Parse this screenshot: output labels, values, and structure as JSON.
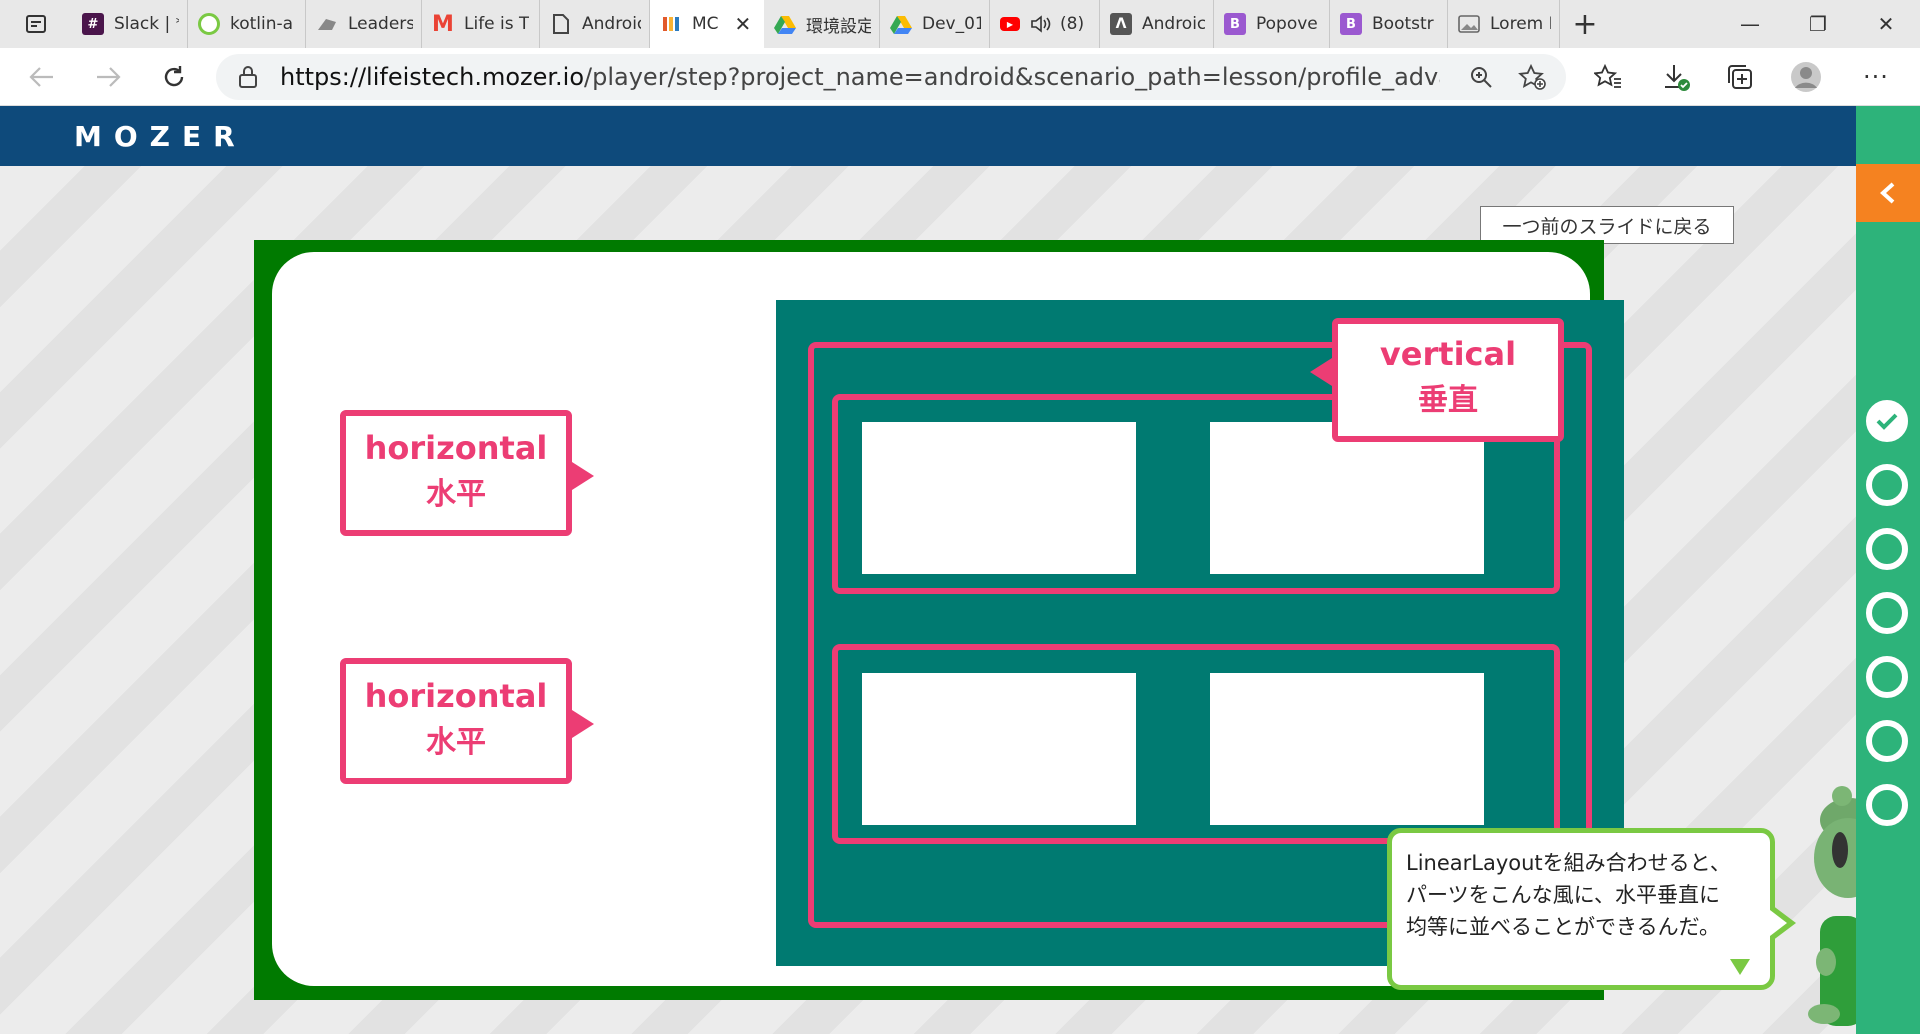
{
  "browser": {
    "tabs": [
      {
        "label": "Slack | *",
        "icon": "slack-icon",
        "color": "#4a154b"
      },
      {
        "label": "kotlin-a",
        "icon": "kotlin-icon",
        "color": "#7ac943"
      },
      {
        "label": "Leaders",
        "icon": "cloud-icon",
        "color": "#888888"
      },
      {
        "label": "Life is T",
        "icon": "gmail-icon",
        "color": "#ea4335"
      },
      {
        "label": "Androic",
        "icon": "page-icon",
        "color": "#555555"
      },
      {
        "label": "MC",
        "icon": "mozer-icon",
        "color": "#e25a2b",
        "active": true
      },
      {
        "label": "環境設定",
        "icon": "drive-icon",
        "color": "#34a853"
      },
      {
        "label": "Dev_01",
        "icon": "drive-icon",
        "color": "#fbbc04"
      },
      {
        "label": "(8)",
        "icon": "youtube-icon",
        "color": "#ff0000"
      },
      {
        "label": "Androic",
        "icon": "android-icon",
        "color": "#555555"
      },
      {
        "label": "Popove",
        "icon": "bootstrap-icon",
        "color": "#9b59d0"
      },
      {
        "label": "Bootstr",
        "icon": "bootstrap-icon",
        "color": "#9b59d0"
      },
      {
        "label": "Lorem I",
        "icon": "image-icon",
        "color": "#777777"
      }
    ],
    "url_host": "https://lifeistech.mozer.io",
    "url_path": "/player/step?project_name=android&scenario_path=lesson/profile_advance&step_..."
  },
  "app": {
    "logo": "MOZER",
    "header_color": "#0e4a7b"
  },
  "stage": {
    "prev_slide_button": "一つ前のスライドに戻る"
  },
  "slide": {
    "vertical_callout": {
      "en": "vertical",
      "jp": "垂直"
    },
    "horizontal_callout_top": {
      "en": "horizontal",
      "jp": "水平"
    },
    "horizontal_callout_bottom": {
      "en": "horizontal",
      "jp": "水平"
    },
    "accent_color": "#ec3d74",
    "teal_color": "#007a71",
    "frame_color": "#007a00"
  },
  "bubble": {
    "line1": "LinearLayoutを組み合わせると、",
    "line2": "パーツをこんな風に、水平垂直に",
    "line3": "均等に並べることができるんだ。"
  },
  "progress": {
    "steps": [
      {
        "state": "done"
      },
      {
        "state": "todo"
      },
      {
        "state": "todo"
      },
      {
        "state": "todo"
      },
      {
        "state": "todo"
      },
      {
        "state": "todo"
      },
      {
        "state": "todo"
      }
    ],
    "sidebar_color": "#2db37a",
    "collapse_color": "#f58220"
  }
}
